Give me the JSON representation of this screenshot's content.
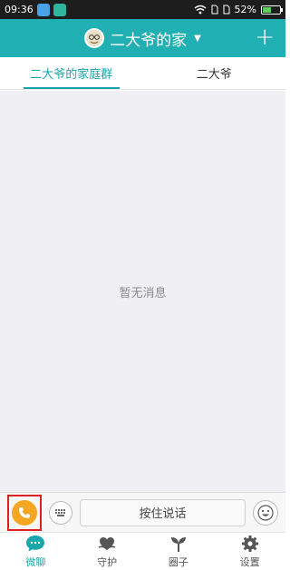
{
  "status_bar": {
    "time": "09:36",
    "battery": "52%",
    "battery_level": 0.52,
    "icons": [
      "weather-app-icon",
      "usb-app-icon",
      "wifi-icon",
      "sim1-icon",
      "sim2-icon",
      "battery-icon"
    ]
  },
  "header": {
    "title": "二大爷的家",
    "caret": "▼",
    "add_label": "+"
  },
  "tabs": [
    {
      "label": "二大爷的家庭群",
      "active": true
    },
    {
      "label": "二大爷",
      "active": false
    }
  ],
  "content": {
    "empty_text": "暂无消息"
  },
  "input_bar": {
    "talk_label": "按住说话",
    "call_icon": "phone-icon",
    "keyboard_icon": "keyboard-icon",
    "emoji_icon": "emoji-icon"
  },
  "bottom_nav": [
    {
      "label": "微聊",
      "icon": "chat-icon",
      "active": true
    },
    {
      "label": "守护",
      "icon": "guard-icon",
      "active": false
    },
    {
      "label": "圈子",
      "icon": "sprout-icon",
      "active": false
    },
    {
      "label": "设置",
      "icon": "gear-icon",
      "active": false
    }
  ],
  "colors": {
    "accent": "#20b0b4",
    "call": "#f5a623",
    "highlight": "#e02020"
  }
}
